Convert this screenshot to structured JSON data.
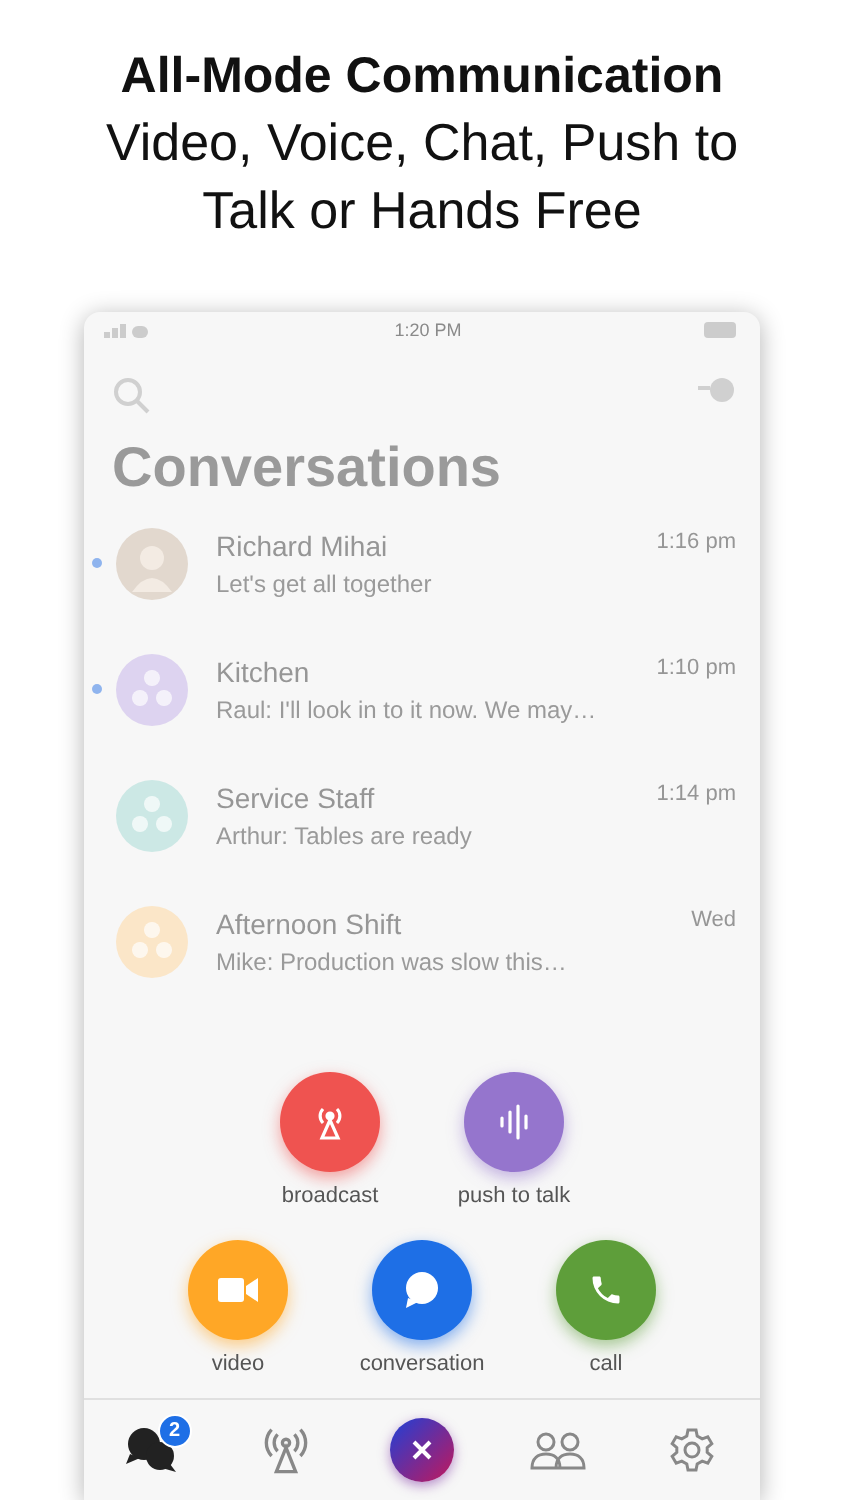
{
  "headline": {
    "title": "All-Mode Communication",
    "subtitle": "Video, Voice, Chat, Push to Talk or Hands Free"
  },
  "phone": {
    "status_time": "1:20 PM",
    "screen_title": "Conversations",
    "conversations": [
      {
        "kind": "person",
        "name": "Richard Mihai",
        "preview": "Let's get all together",
        "time": "1:16 pm",
        "unread": true,
        "color": "#e2d8ce"
      },
      {
        "kind": "group",
        "name": "Kitchen",
        "preview": "Raul: I'll look in to it now. We may…",
        "time": "1:10 pm",
        "unread": true,
        "color": "#ddd3f0"
      },
      {
        "kind": "group",
        "name": "Service Staff",
        "preview": "Arthur: Tables are ready",
        "time": "1:14 pm",
        "unread": false,
        "color": "#cce8e5"
      },
      {
        "kind": "group",
        "name": "Afternoon Shift",
        "preview": "Mike: Production was slow this…",
        "time": "Wed",
        "unread": false,
        "color": "#fbe6c8"
      }
    ],
    "actions": [
      {
        "kind": "broadcast",
        "label": "broadcast",
        "color": "#ef5350"
      },
      {
        "kind": "ptt",
        "label": "push to talk",
        "color": "#9575cd"
      },
      {
        "kind": "video",
        "label": "video",
        "color": "#ffa726"
      },
      {
        "kind": "conversation",
        "label": "conversation",
        "color": "#1e6fe6"
      },
      {
        "kind": "call",
        "label": "call",
        "color": "#5e9e3a"
      }
    ],
    "nav": [
      {
        "kind": "chats",
        "badge": "2",
        "selected": true
      },
      {
        "kind": "broadcast",
        "selected": false
      },
      {
        "kind": "close",
        "selected": false
      },
      {
        "kind": "contacts",
        "selected": false
      },
      {
        "kind": "settings",
        "selected": false
      }
    ]
  }
}
